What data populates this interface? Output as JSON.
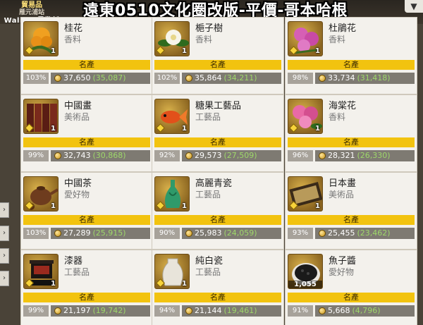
{
  "app": {
    "logo_lines": [
      "貿易品",
      "雁元浦站",
      "Wallace暴動斬"
    ],
    "banner": "遠東0510文化圈改版-平價-哥本哈根",
    "pin_icon": "pin-icon"
  },
  "rank_label": "名產",
  "cards": [
    {
      "name": "桂花",
      "category": "香料",
      "qty": "1",
      "percent": "103%",
      "price": "37,650",
      "base": "35,087",
      "icon": "osmanthus-icon"
    },
    {
      "name": "梔子樹",
      "category": "香料",
      "qty": "1",
      "percent": "102%",
      "price": "35,864",
      "base": "34,211",
      "icon": "gardenia-icon"
    },
    {
      "name": "杜鵑花",
      "category": "香料",
      "qty": "1",
      "percent": "98%",
      "price": "33,734",
      "base": "31,418",
      "icon": "azalea-icon"
    },
    {
      "name": "中國畫",
      "category": "美術品",
      "qty": "1",
      "percent": "99%",
      "price": "32,743",
      "base": "30,868",
      "icon": "folding-screen-icon"
    },
    {
      "name": "糖果工藝品",
      "category": "工藝品",
      "qty": "1",
      "percent": "92%",
      "price": "29,573",
      "base": "27,509",
      "icon": "goldfish-candy-icon"
    },
    {
      "name": "海棠花",
      "category": "香料",
      "qty": "1",
      "percent": "96%",
      "price": "28,321",
      "base": "26,330",
      "icon": "begonia-icon"
    },
    {
      "name": "中國茶",
      "category": "愛好物",
      "qty": "1",
      "percent": "103%",
      "price": "27,289",
      "base": "25,915",
      "icon": "teapot-icon"
    },
    {
      "name": "高麗青瓷",
      "category": "工藝品",
      "qty": "1",
      "percent": "90%",
      "price": "25,983",
      "base": "24,059",
      "icon": "celadon-vase-icon"
    },
    {
      "name": "日本畫",
      "category": "美術品",
      "qty": "1",
      "percent": "93%",
      "price": "25,455",
      "base": "23,462",
      "icon": "scroll-painting-icon"
    },
    {
      "name": "漆器",
      "category": "工藝品",
      "qty": "1",
      "percent": "99%",
      "price": "21,197",
      "base": "19,742",
      "icon": "lacquerware-icon"
    },
    {
      "name": "純白瓷",
      "category": "工藝品",
      "qty": "1",
      "percent": "94%",
      "price": "21,144",
      "base": "19,461",
      "icon": "white-porcelain-icon"
    },
    {
      "name": "魚子醬",
      "category": "愛好物",
      "qty": "1,055",
      "percent": "91%",
      "price": "5,668",
      "base": "4,796",
      "icon": "caviar-icon"
    }
  ],
  "colors": {
    "rank_bar": "#f2c30f",
    "price_bg": "#7e7a72",
    "base_price": "#9ed86a",
    "background": "#4a4338"
  }
}
